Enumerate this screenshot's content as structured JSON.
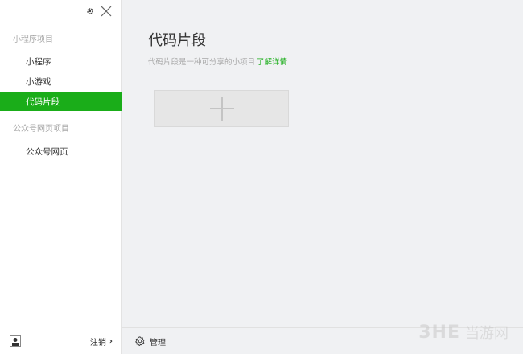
{
  "sidebar": {
    "sections": [
      {
        "label": "小程序项目",
        "items": [
          {
            "label": "小程序"
          },
          {
            "label": "小游戏"
          },
          {
            "label": "代码片段"
          }
        ]
      },
      {
        "label": "公众号网页项目",
        "items": [
          {
            "label": "公众号网页"
          }
        ]
      }
    ],
    "active_item": "代码片段",
    "logout_label": "注销"
  },
  "main": {
    "title": "代码片段",
    "description": "代码片段是一种可分享的小项目",
    "learn_more_label": "了解详情",
    "manage_label": "管理"
  },
  "watermark": {
    "logo": "3HE",
    "text": "当游网"
  },
  "colors": {
    "accent": "#1aad19",
    "background": "#f0f1f3",
    "sidebar": "#ffffff"
  },
  "icons": [
    "settings-icon",
    "close-icon",
    "plus-icon",
    "gear-icon",
    "avatar",
    "chevron-right-icon"
  ]
}
